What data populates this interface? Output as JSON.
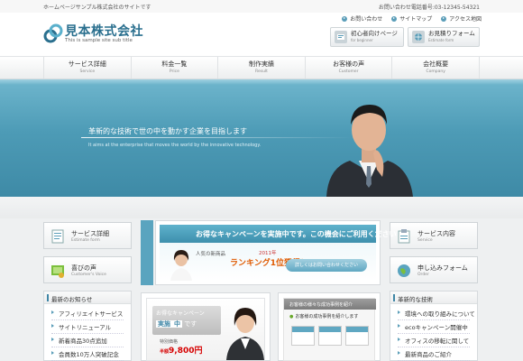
{
  "topbar": {
    "tagline": "ホームページサンプル株式会社のサイトです",
    "phone": "お問い合わせ電話番号:03-12345-54321"
  },
  "header": {
    "logo_title": "見本株式会社",
    "logo_sub": "This is sample site sub title",
    "util_links": [
      "お問い合わせ",
      "サイトマップ",
      "アクセス地図"
    ],
    "btn_beginner": {
      "label": "初心者向けページ",
      "sub": "for beginner"
    },
    "btn_estimate": {
      "label": "お見積りフォーム",
      "sub": "Estimate form"
    }
  },
  "nav": [
    {
      "jp": "サービス詳細",
      "en": "Service"
    },
    {
      "jp": "料金一覧",
      "en": "Price"
    },
    {
      "jp": "制作実績",
      "en": "Result"
    },
    {
      "jp": "お客様の声",
      "en": "Customer"
    },
    {
      "jp": "会社概要",
      "en": "Company"
    }
  ],
  "hero": {
    "title": "革新的な技術で世の中を動かす企業を目指します",
    "sub": "It aims at the enterprise that moves the world by the innovative technology."
  },
  "left_boxes": [
    {
      "title": "サービス詳細",
      "sub": "Estimate form"
    },
    {
      "title": "喜びの声",
      "sub": "Customer's Voice"
    }
  ],
  "right_boxes": [
    {
      "title": "サービス内容",
      "sub": "Service"
    },
    {
      "title": "申し込みフォーム",
      "sub": "Order"
    }
  ],
  "news_panel": {
    "title": "最新のお知らせ",
    "items": [
      "アフィリエイトサービス",
      "サイトリニューアル",
      "新着商品30点追加",
      "会員数10万人突破記念"
    ]
  },
  "tech_panel": {
    "title": "革新的な技術",
    "items": [
      "環境への取り組みについて",
      "ecoキャンペーン開催中",
      "オフィスの移転に関して",
      "最新商品のご紹介"
    ]
  },
  "campaign": {
    "head": "お得なキャンペーンを実施中です。この機会にご利用ください",
    "popular": "人気の新商品",
    "year": "2011年",
    "rank": "ランキング1位獲得！",
    "button": "詳しくはお問い合わせください"
  },
  "promo": {
    "line1": "お得なキャンペーン",
    "line2_a": "実施",
    "line2_b": "中",
    "line2_c": "です",
    "price_label": "特別価格",
    "price": "9,800円",
    "price_prefix": "半額"
  },
  "cases": {
    "head": "お客様の様々な成功事例を紹介",
    "sub": "お客様の成功事例を紹介します"
  },
  "colors": {
    "accent": "#3f86a6",
    "hero": "#4d9bb6",
    "price": "#d60000"
  }
}
